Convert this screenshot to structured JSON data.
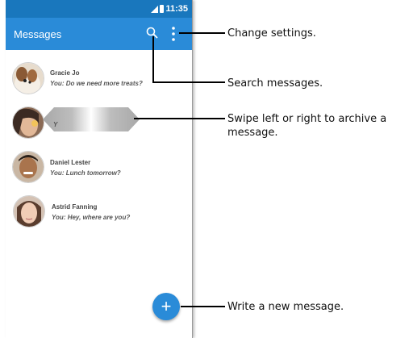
{
  "status_bar": {
    "time": "11:35",
    "signal_icon": "signal-icon",
    "battery_icon": "battery-icon"
  },
  "app_bar": {
    "title": "Messages",
    "search_icon": "search-icon",
    "menu_icon": "more-vert-icon"
  },
  "messages": [
    {
      "sender": "Gracie Jo",
      "snippet": "You: Do we need more treats?",
      "avatar": "dog-avatar"
    },
    {
      "sender": "",
      "snippet": "Y",
      "avatar": "person-avatar",
      "state": "swiping"
    },
    {
      "sender": "Daniel Lester",
      "snippet": "You: Lunch tomorrow?",
      "avatar": "person-avatar"
    },
    {
      "sender": "Astrid Fanning",
      "snippet": "You: Hey, where are you?",
      "avatar": "person-avatar"
    }
  ],
  "fab": {
    "label": "+",
    "icon": "plus-icon"
  },
  "callouts": [
    {
      "text": "Change settings."
    },
    {
      "text": "Search messages."
    },
    {
      "text": "Swipe left or right to archive a message."
    },
    {
      "text": "Write a new message."
    }
  ],
  "colors": {
    "status_bar": "#1977bd",
    "app_bar": "#2a8bd8",
    "fab": "#2a8bd8"
  }
}
